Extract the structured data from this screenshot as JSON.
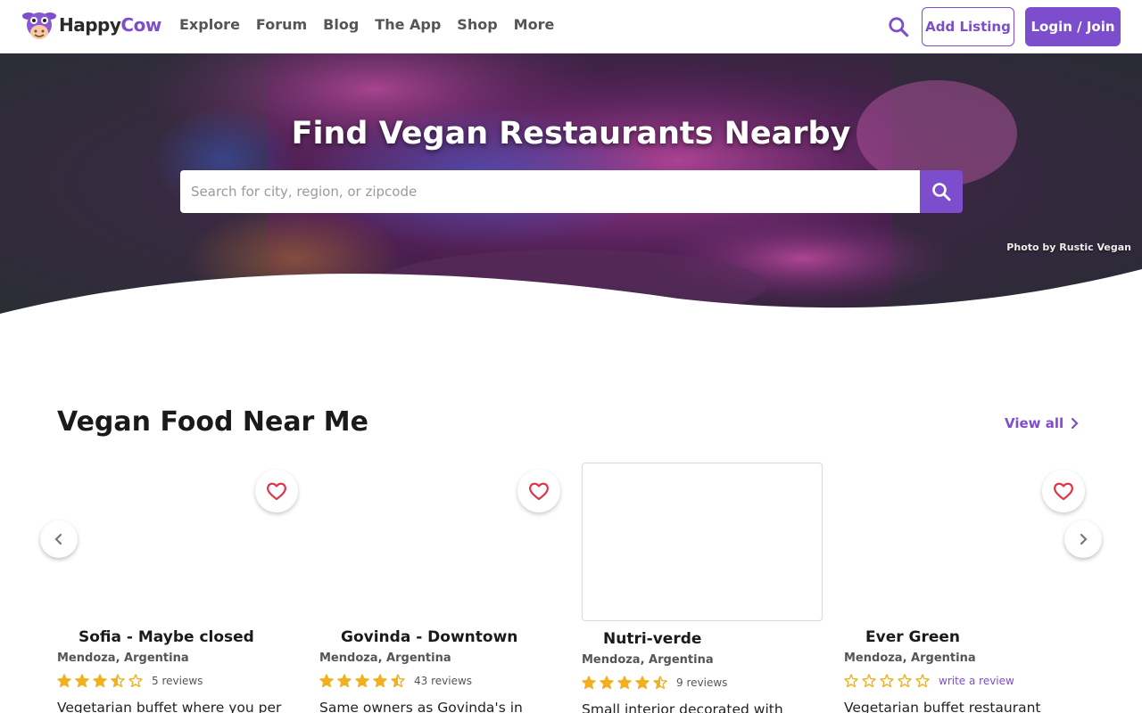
{
  "header": {
    "logo": {
      "happy": "Happy",
      "cow": "Cow"
    },
    "nav": [
      "Explore",
      "Forum",
      "Blog",
      "The App",
      "Shop",
      "More"
    ],
    "add_listing": "Add Listing",
    "login": "Login / Join"
  },
  "hero": {
    "title": "Find Vegan Restaurants Nearby",
    "search_placeholder": "Search for city, region, or zipcode",
    "photo_credit": "Photo by Rustic Vegan"
  },
  "section": {
    "title": "Vegan Food Near Me",
    "view_all": "View all"
  },
  "cards": [
    {
      "name": "Sofia - Maybe closed",
      "location": "Mendoza, Argentina",
      "rating": 3.5,
      "reviews": "5 reviews",
      "description": "Vegetarian buffet where you per"
    },
    {
      "name": "Govinda - Downtown",
      "location": "Mendoza, Argentina",
      "rating": 4.5,
      "reviews": "43 reviews",
      "description": "Same owners as Govinda's in"
    },
    {
      "name": "Nutri-verde",
      "location": "Mendoza, Argentina",
      "rating": 4.5,
      "reviews": "9 reviews",
      "description": "Small interior decorated with"
    },
    {
      "name": "Ever Green",
      "location": "Mendoza, Argentina",
      "rating": 0,
      "reviews": "write a review",
      "description": "Vegetarian buffet restaurant"
    }
  ],
  "colors": {
    "brand": "#7c4dcc",
    "star": "#f2b01e"
  }
}
